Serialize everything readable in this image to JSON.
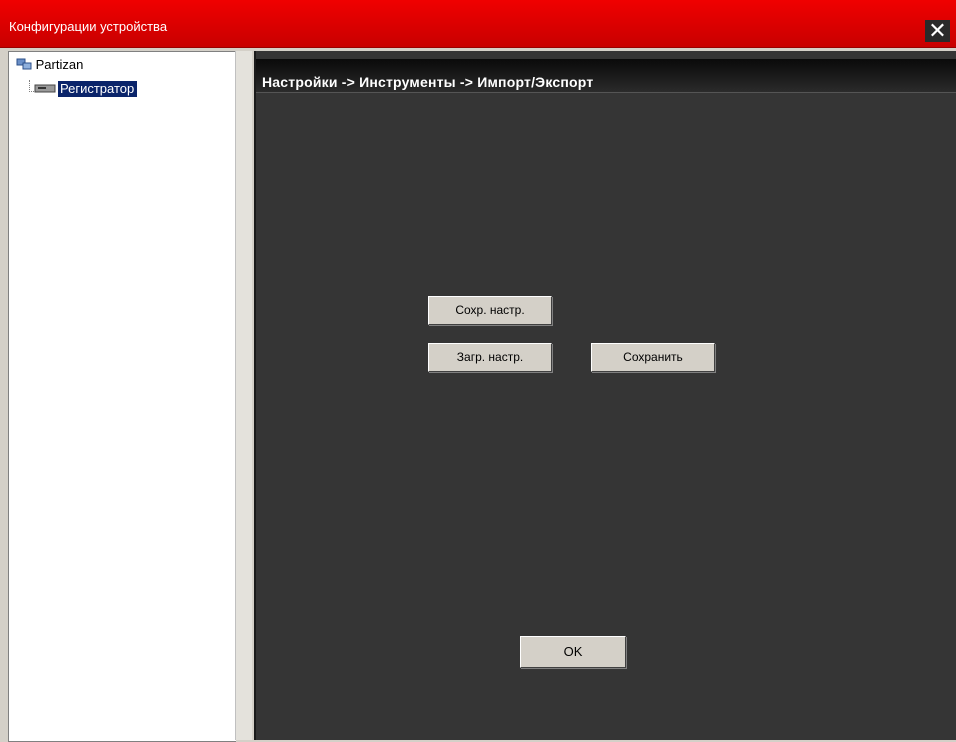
{
  "window": {
    "title": "Конфигурации устройства",
    "close_icon": "close-icon"
  },
  "tree": {
    "root": {
      "label": "Partizan",
      "icon": "network-icon"
    },
    "children": [
      {
        "label": "Регистратор",
        "icon": "dvr-icon",
        "selected": true
      }
    ]
  },
  "content": {
    "breadcrumb": "Настройки -> Инструменты -> Импорт/Экспорт",
    "buttons": {
      "save_config": "Сохр. настр.",
      "load_config": "Загр. настр.",
      "save": "Сохранить",
      "ok": "OK"
    }
  },
  "colors": {
    "title_bar": "#e00000",
    "content_bg": "#353535",
    "selection": "#0a246a"
  }
}
